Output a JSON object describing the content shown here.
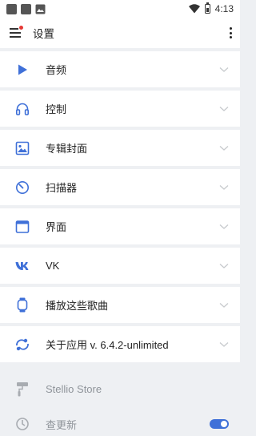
{
  "status_bar": {
    "time": "4:13"
  },
  "app_bar": {
    "title": "设置"
  },
  "settings": [
    {
      "label": "音频",
      "icon": "play-icon"
    },
    {
      "label": "控制",
      "icon": "headphones-icon"
    },
    {
      "label": "专辑封面",
      "icon": "image-icon"
    },
    {
      "label": "扫描器",
      "icon": "scanner-gauge-icon"
    },
    {
      "label": "界面",
      "icon": "window-icon"
    },
    {
      "label": "VK",
      "icon": "vk-logo-icon"
    },
    {
      "label": "播放这些歌曲",
      "icon": "watch-icon"
    },
    {
      "label": "关于应用 v. 6.4.2-unlimited",
      "icon": "app-logo-icon"
    }
  ],
  "store": {
    "label": "Stellio Store",
    "update_label": "查更新",
    "update_toggle_on": true
  },
  "colors": {
    "accent": "#3f70d8",
    "badge": "#e53935"
  }
}
